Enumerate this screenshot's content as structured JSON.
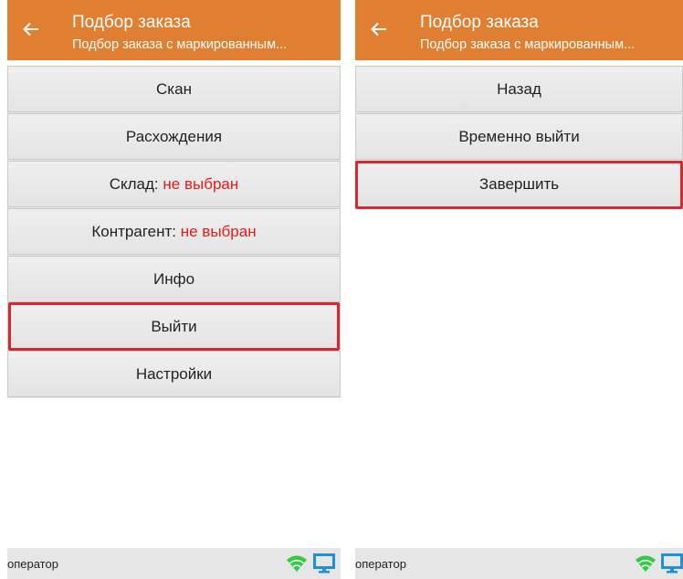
{
  "left_screen": {
    "title": "Подбор заказа",
    "subtitle": "Подбор заказа с маркированным...",
    "menu": {
      "scan": "Скан",
      "diff": "Расхождения",
      "warehouse_label": "Склад: ",
      "warehouse_value": "не выбран",
      "counterparty_label": "Контрагент: ",
      "counterparty_value": "не выбран",
      "info": "Инфо",
      "exit": "Выйти",
      "settings": "Настройки"
    },
    "status": {
      "operator": "оператор"
    }
  },
  "right_screen": {
    "title": "Подбор заказа",
    "subtitle": "Подбор заказа с маркированным...",
    "menu": {
      "back": "Назад",
      "temp_exit": "Временно выйти",
      "finish": "Завершить"
    },
    "status": {
      "operator": "оператор"
    }
  },
  "colors": {
    "appbar": "#E07F31",
    "highlight": "#d8282f",
    "not_selected": "#e21b1b",
    "wifi": "#2ecc40",
    "monitor": "#1e90d6"
  },
  "icons": [
    "back-arrow-icon",
    "wifi-icon",
    "monitor-icon"
  ]
}
